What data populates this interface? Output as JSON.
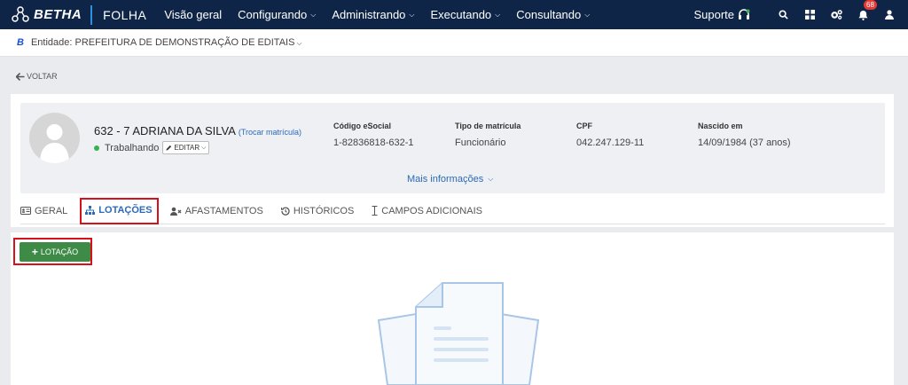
{
  "topbar": {
    "brand": "BETHA",
    "product": "FOLHA",
    "nav": [
      "Visão geral",
      "Configurando",
      "Administrando",
      "Executando",
      "Consultando"
    ],
    "suporte": "Suporte",
    "notifications_count": "68"
  },
  "entidade": {
    "icon_letter": "B",
    "text": "Entidade: PREFEITURA DE DEMONSTRAÇÃO DE EDITAIS"
  },
  "back": {
    "label": "VOLTAR"
  },
  "employee": {
    "name": "632 - 7 ADRIANA DA SILVA",
    "trocar": "(Trocar matrícula)",
    "status": "Trabalhando",
    "editar": "EDITAR",
    "fields": [
      {
        "label": "Código eSocial",
        "value": "1-82836818-632-1"
      },
      {
        "label": "Tipo de matrícula",
        "value": "Funcionário"
      },
      {
        "label": "CPF",
        "value": "042.247.129-11"
      },
      {
        "label": "Nascido em",
        "value": "14/09/1984 (37 anos)"
      }
    ],
    "mais": "Mais informações"
  },
  "tabs": [
    {
      "label": "GERAL",
      "icon": "id-card-icon"
    },
    {
      "label": "LOTAÇÕES",
      "icon": "sitemap-icon",
      "active": true
    },
    {
      "label": "AFASTAMENTOS",
      "icon": "user-x-icon"
    },
    {
      "label": "HISTÓRICOS",
      "icon": "history-icon"
    },
    {
      "label": "CAMPOS ADICIONAIS",
      "icon": "text-cursor-icon"
    }
  ],
  "actions": {
    "add_lotacao": "LOTAÇÃO"
  },
  "colors": {
    "topbar": "#0f2547",
    "accent": "#2a6ab8",
    "add_button": "#3d8b47",
    "highlight": "#d8101a",
    "status": "#37b24d"
  }
}
